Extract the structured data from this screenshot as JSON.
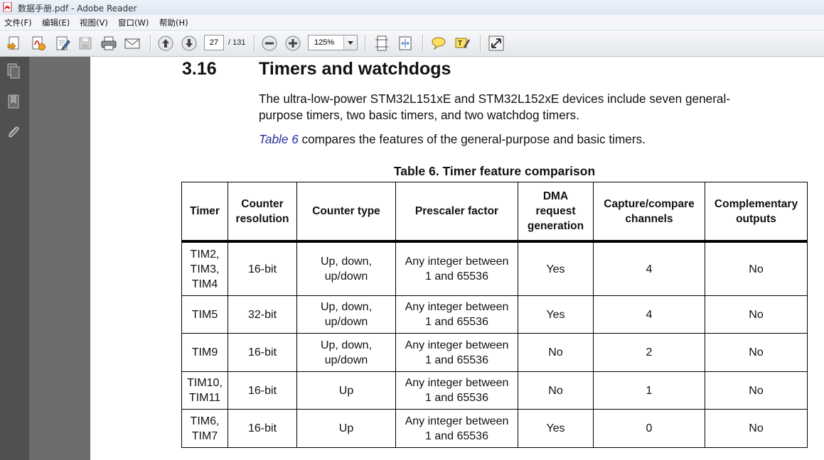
{
  "window": {
    "title": "数据手册.pdf - Adobe Reader"
  },
  "menu": [
    "文件(F)",
    "编辑(E)",
    "视图(V)",
    "窗口(W)",
    "帮助(H)"
  ],
  "toolbar": {
    "current_page": "27",
    "total_pages": "/ 131",
    "zoom": "125%"
  },
  "document": {
    "section_number": "3.16",
    "section_title": "Timers and watchdogs",
    "intro_line1": "The ultra-low-power STM32L151xE and STM32L152xE devices include seven general-",
    "intro_line2": "purpose timers, two basic timers, and two watchdog timers.",
    "intro_link": "Table 6",
    "intro_rest": " compares the features of the general-purpose and basic timers.",
    "table_caption": "Table 6. Timer feature comparison",
    "table": {
      "headers": [
        [
          "Timer"
        ],
        [
          "Counter",
          "resolution"
        ],
        [
          "Counter type"
        ],
        [
          "Prescaler factor"
        ],
        [
          "DMA",
          "request",
          "generation"
        ],
        [
          "Capture/compare",
          "channels"
        ],
        [
          "Complementary",
          "outputs"
        ]
      ],
      "rows": [
        [
          [
            "TIM2,",
            "TIM3,",
            "TIM4"
          ],
          [
            "16-bit"
          ],
          [
            "Up, down,",
            "up/down"
          ],
          [
            "Any integer between",
            "1 and 65536"
          ],
          [
            "Yes"
          ],
          [
            "4"
          ],
          [
            "No"
          ]
        ],
        [
          [
            "TIM5"
          ],
          [
            "32-bit"
          ],
          [
            "Up, down,",
            "up/down"
          ],
          [
            "Any integer between",
            "1 and 65536"
          ],
          [
            "Yes"
          ],
          [
            "4"
          ],
          [
            "No"
          ]
        ],
        [
          [
            "TIM9"
          ],
          [
            "16-bit"
          ],
          [
            "Up, down,",
            "up/down"
          ],
          [
            "Any integer between",
            "1 and 65536"
          ],
          [
            "No"
          ],
          [
            "2"
          ],
          [
            "No"
          ]
        ],
        [
          [
            "TIM10,",
            "TIM11"
          ],
          [
            "16-bit"
          ],
          [
            "Up"
          ],
          [
            "Any integer between",
            "1 and 65536"
          ],
          [
            "No"
          ],
          [
            "1"
          ],
          [
            "No"
          ]
        ],
        [
          [
            "TIM6,",
            "TIM7"
          ],
          [
            "16-bit"
          ],
          [
            "Up"
          ],
          [
            "Any integer between",
            "1 and 65536"
          ],
          [
            "Yes"
          ],
          [
            "0"
          ],
          [
            "No"
          ]
        ]
      ]
    }
  }
}
